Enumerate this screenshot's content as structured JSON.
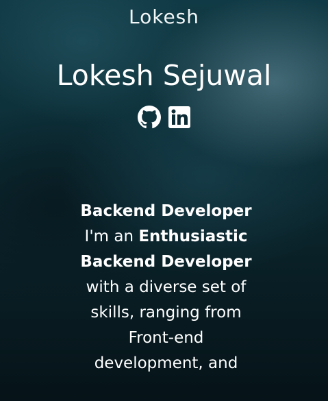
{
  "header": {
    "brand": "Lokesh"
  },
  "hero": {
    "name": "Lokesh Sejuwal",
    "socials": [
      {
        "icon": "github-icon",
        "label": "GitHub"
      },
      {
        "icon": "linkedin-icon",
        "label": "LinkedIn"
      }
    ]
  },
  "bio": {
    "role": "Backend Developer",
    "intro": "I'm an",
    "highlight": "Enthusiastic Backend Developer",
    "rest": "with a diverse set of skills, ranging from Front-end development, and"
  },
  "colors": {
    "background": "#0a2229",
    "text": "#ffffff"
  }
}
